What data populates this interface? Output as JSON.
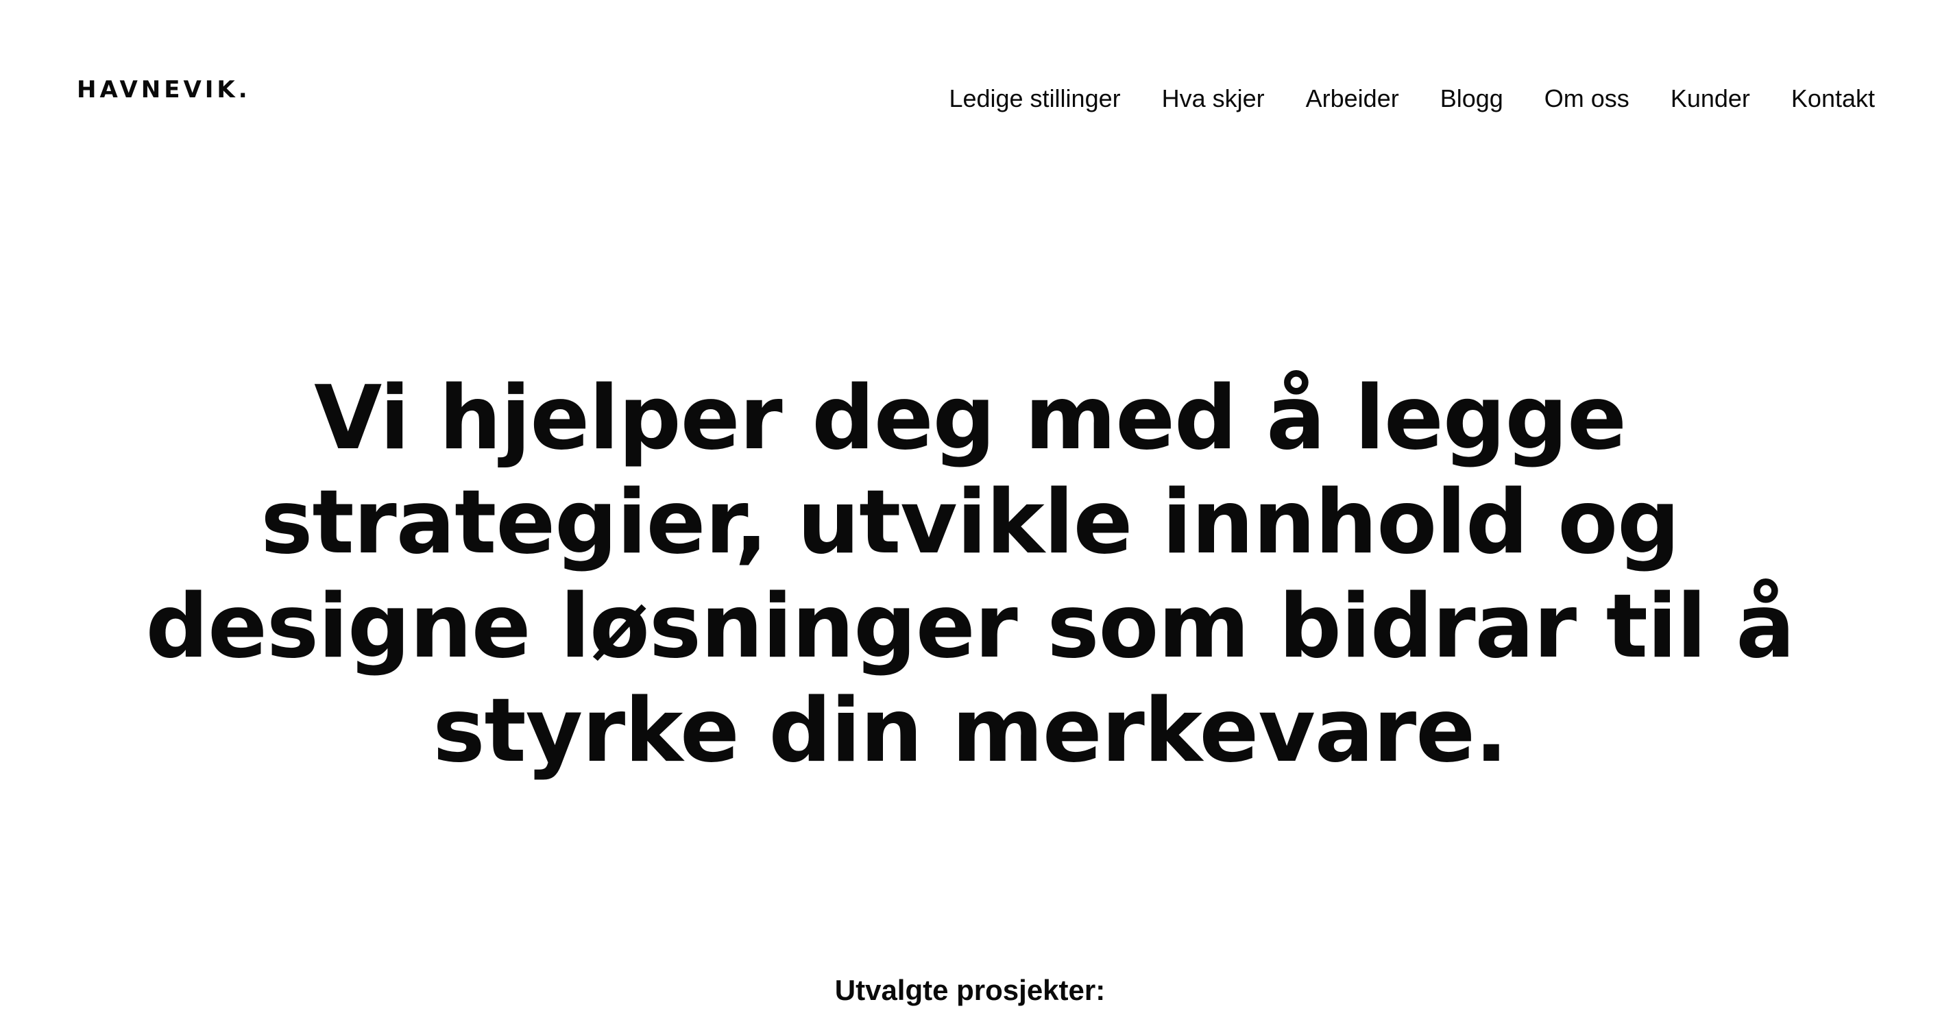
{
  "header": {
    "logo_text": "HAVNEVIK."
  },
  "nav": {
    "items": [
      {
        "label": "Ledige stillinger"
      },
      {
        "label": "Hva skjer"
      },
      {
        "label": "Arbeider"
      },
      {
        "label": "Blogg"
      },
      {
        "label": "Om oss"
      },
      {
        "label": "Kunder"
      },
      {
        "label": "Kontakt"
      }
    ]
  },
  "hero": {
    "title": "Vi hjelper deg med å legge strategier, utvikle innhold og designe løsninger som bidrar til å styrke din merkevare."
  },
  "featured": {
    "heading": "Utvalgte prosjekter:"
  }
}
